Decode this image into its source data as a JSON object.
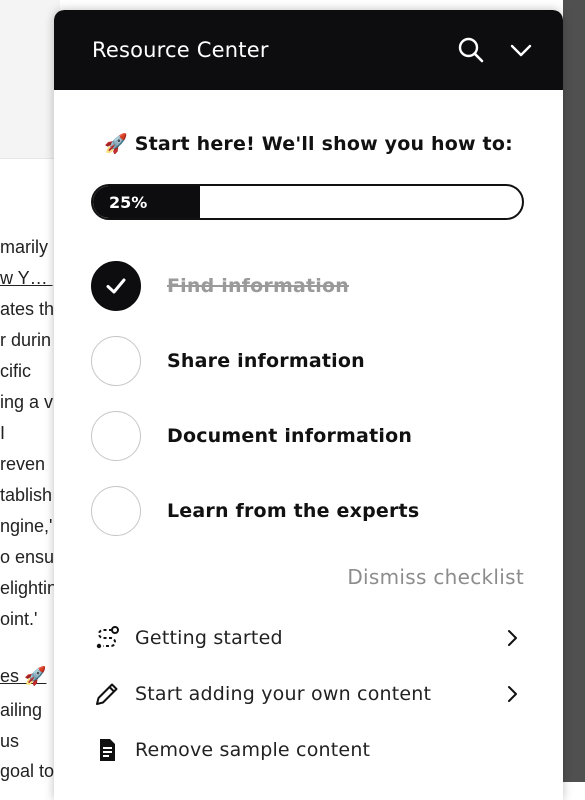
{
  "background": {
    "lines": [
      "marily",
      "w Y… ,",
      "ates th",
      "r durin",
      "cific",
      "ing a v",
      "I",
      "reven",
      "tablish",
      "ngine,'",
      "o ensu",
      "elightin",
      "oint.'",
      "",
      "es 🚀",
      "ailing",
      "us",
      "goal to"
    ]
  },
  "panel": {
    "title": "Resource Center",
    "search_icon": "search-icon",
    "collapse_icon": "chevron-down-icon"
  },
  "checklist": {
    "subtitle": "🚀 Start here! We'll show you how to:",
    "progress": 0.25,
    "progress_text": "25%",
    "tasks": [
      {
        "label": "Find information",
        "done": true
      },
      {
        "label": "Share information",
        "done": false
      },
      {
        "label": "Document information",
        "done": false
      },
      {
        "label": "Learn from the experts",
        "done": false
      }
    ],
    "dismiss_label": "Dismiss checklist"
  },
  "menu": {
    "items": [
      {
        "label": "Getting started",
        "icon": "route-icon",
        "has_chevron": true
      },
      {
        "label": "Start adding your own content",
        "icon": "pencil-icon",
        "has_chevron": true
      },
      {
        "label": "Remove sample content",
        "icon": "document-icon",
        "has_chevron": false
      }
    ]
  },
  "colors": {
    "header_bg": "#0d0d0f",
    "progress_fill": "#0d0d0f",
    "done_text": "#9a9a9a",
    "dismiss_text": "#8c8c8c"
  }
}
